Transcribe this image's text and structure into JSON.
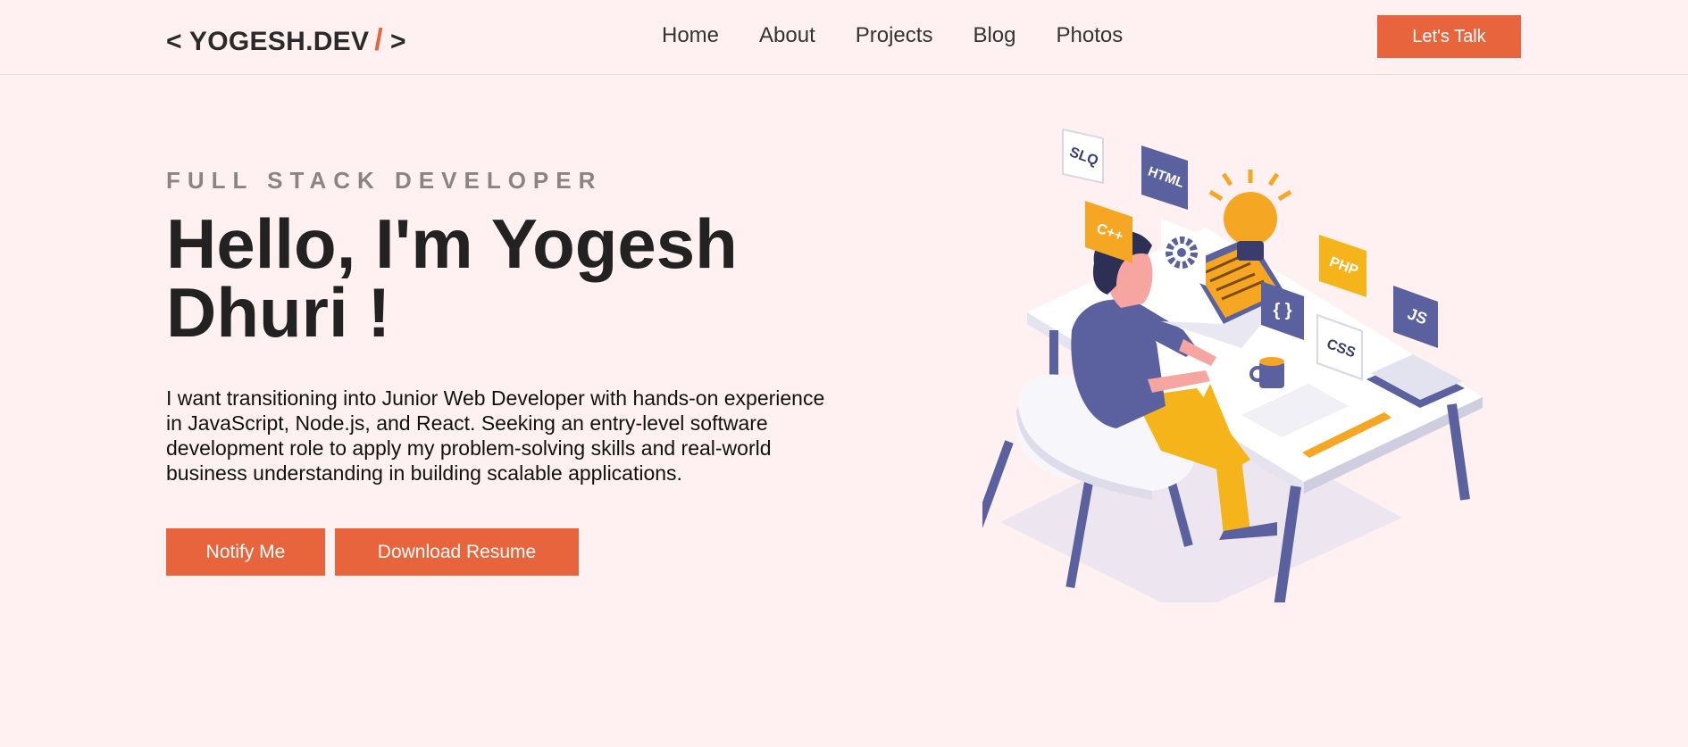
{
  "header": {
    "logo": {
      "open": "< YOGESH.DEV",
      "slash": "/",
      "close": ">"
    },
    "nav": [
      "Home",
      "About",
      "Projects",
      "Blog",
      "Photos"
    ],
    "cta_label": "Let's Talk"
  },
  "hero": {
    "eyebrow": "FULL STACK DEVELOPER",
    "headline": "Hello, I'm Yogesh Dhuri !",
    "intro": "I want transitioning into Junior Web Developer with hands-on experience in JavaScript, Node.js, and React. Seeking an entry-level software development role to apply my problem-solving skills and real-world business understanding in building scalable applications.",
    "buttons": {
      "notify": "Notify Me",
      "resume": "Download Resume"
    }
  },
  "illustration": {
    "tags": [
      "SLQ",
      "HTML",
      "C++",
      "PHP",
      "JS",
      "CSS",
      "{ }"
    ]
  },
  "colors": {
    "background": "#fff1f1",
    "accent": "#e8643c",
    "indigo": "#5b609e",
    "amber": "#f5a623"
  }
}
